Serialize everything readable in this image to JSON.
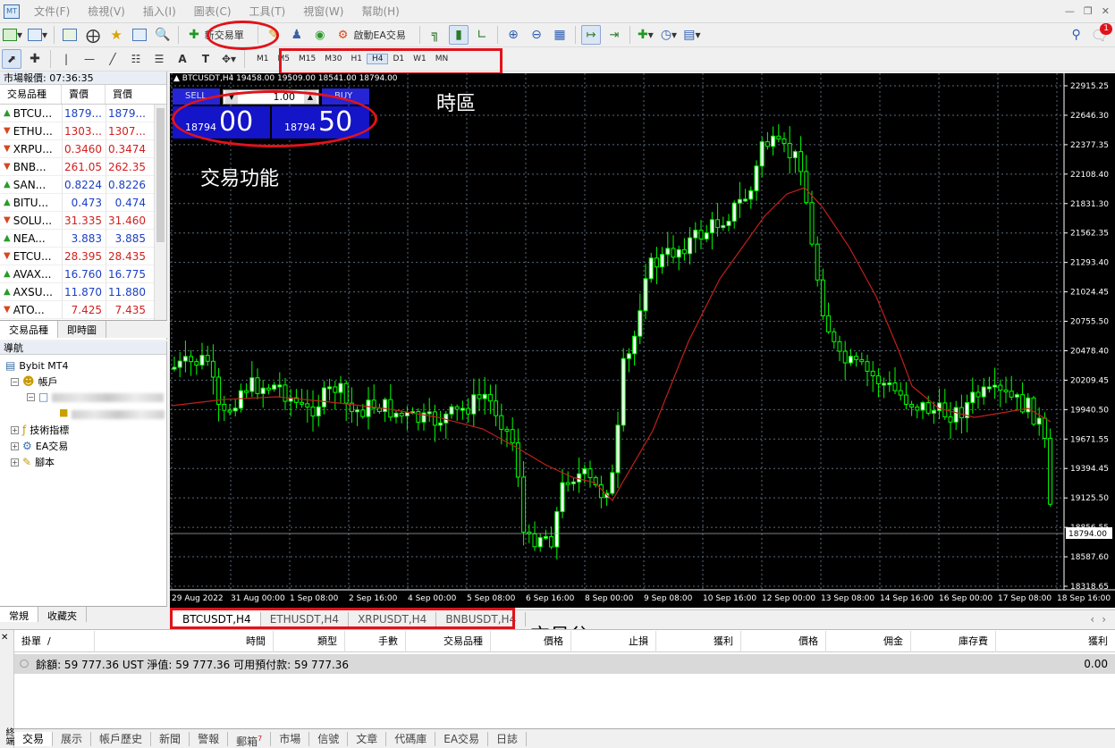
{
  "menu": {
    "items": [
      "文件(F)",
      "檢視(V)",
      "插入(I)",
      "圖表(C)",
      "工具(T)",
      "視窗(W)",
      "幫助(H)"
    ]
  },
  "toolbar": {
    "new_order_label": "新交易單",
    "auto_trading_label": "啟動EA交易",
    "timeframes": [
      "M1",
      "M5",
      "M15",
      "M30",
      "H1",
      "H4",
      "D1",
      "W1",
      "MN"
    ],
    "notification_count": "1"
  },
  "market_watch": {
    "title": "市場報價: 07:36:35",
    "col_symbol": "交易品種",
    "col_bid": "賣價",
    "col_ask": "買價",
    "rows": [
      {
        "symbol": "BTCU...",
        "bid": "1879...",
        "ask": "1879...",
        "dir": "up"
      },
      {
        "symbol": "ETHU...",
        "bid": "1303...",
        "ask": "1307...",
        "dir": "dn"
      },
      {
        "symbol": "XRPU...",
        "bid": "0.3460",
        "ask": "0.3474",
        "dir": "dn"
      },
      {
        "symbol": "BNB...",
        "bid": "261.05",
        "ask": "262.35",
        "dir": "dn"
      },
      {
        "symbol": "SAN...",
        "bid": "0.8224",
        "ask": "0.8226",
        "dir": "up"
      },
      {
        "symbol": "BITU...",
        "bid": "0.473",
        "ask": "0.474",
        "dir": "up"
      },
      {
        "symbol": "SOLU...",
        "bid": "31.335",
        "ask": "31.460",
        "dir": "dn"
      },
      {
        "symbol": "NEA...",
        "bid": "3.883",
        "ask": "3.885",
        "dir": "up"
      },
      {
        "symbol": "ETCU...",
        "bid": "28.395",
        "ask": "28.435",
        "dir": "dn"
      },
      {
        "symbol": "AVAX...",
        "bid": "16.760",
        "ask": "16.775",
        "dir": "up"
      },
      {
        "symbol": "AXSU...",
        "bid": "11.870",
        "ask": "11.880",
        "dir": "up"
      },
      {
        "symbol": "ATO...",
        "bid": "7.425",
        "ask": "7.435",
        "dir": "dn"
      }
    ],
    "tabs": [
      "交易品種",
      "即時圖"
    ]
  },
  "navigator": {
    "title": "導航",
    "root": "Bybit MT4",
    "accounts": "帳戶",
    "indicators": "技術指標",
    "experts": "EA交易",
    "scripts": "腳本",
    "tabs": [
      "常規",
      "收藏夾"
    ]
  },
  "chart": {
    "info": "BTCUSDT,H4  19458.00 19509.00 18541.00 18794.00",
    "sell_label": "SELL",
    "buy_label": "BUY",
    "lot": "1.00",
    "sell_small": "18794",
    "sell_big": "00",
    "buy_small": "18794",
    "buy_big": "50",
    "current_price": "18794.00",
    "price_labels": [
      "22915.25",
      "22646.30",
      "22377.35",
      "22108.40",
      "21831.30",
      "21562.35",
      "21293.40",
      "21024.45",
      "20755.50",
      "20478.40",
      "20209.45",
      "19940.50",
      "19671.55",
      "19394.45",
      "19125.50",
      "18856.55",
      "18587.60",
      "18318.65"
    ],
    "time_labels": [
      "29 Aug 2022",
      "31 Aug 00:00",
      "1 Sep 08:00",
      "2 Sep 16:00",
      "4 Sep 00:00",
      "5 Sep 08:00",
      "6 Sep 16:00",
      "8 Sep 00:00",
      "9 Sep 08:00",
      "10 Sep 16:00",
      "12 Sep 00:00",
      "13 Sep 08:00",
      "14 Sep 16:00",
      "16 Sep 00:00",
      "17 Sep 08:00",
      "18 Sep 16:00"
    ],
    "tabs": [
      "BTCUSDT,H4",
      "ETHUSDT,H4",
      "XRPUSDT,H4",
      "BNBUSDT,H4"
    ]
  },
  "annotations": {
    "timeframe": "時區",
    "trade_function": "交易功能",
    "trade_window": "交易兌"
  },
  "terminal": {
    "columns": [
      "掛單",
      "/",
      "時間",
      "類型",
      "手數",
      "交易品種",
      "價格",
      "止損",
      "獲利",
      "價格",
      "佣金",
      "庫存費",
      "獲利"
    ],
    "balance_text": "餘額: 59 777.36 UST  淨值: 59 777.36  可用預付款: 59 777.36",
    "balance_profit": "0.00",
    "side_label": "終端",
    "tabs": [
      "交易",
      "展示",
      "帳戶歷史",
      "新聞",
      "警報",
      "郵箱",
      "市場",
      "信號",
      "文章",
      "代碼庫",
      "EA交易",
      "日誌"
    ],
    "mailbox_count": "7"
  },
  "colors": {
    "bull_candle": "#ffffff",
    "bull_outline": "#00ff00",
    "bear_candle": "#000000",
    "wick": "#00ff00",
    "ma_line": "#c0201c",
    "grid": "#5a6a7a",
    "annotation_outline": "#e0131b",
    "buy_sell_panel": "#1414c8"
  }
}
